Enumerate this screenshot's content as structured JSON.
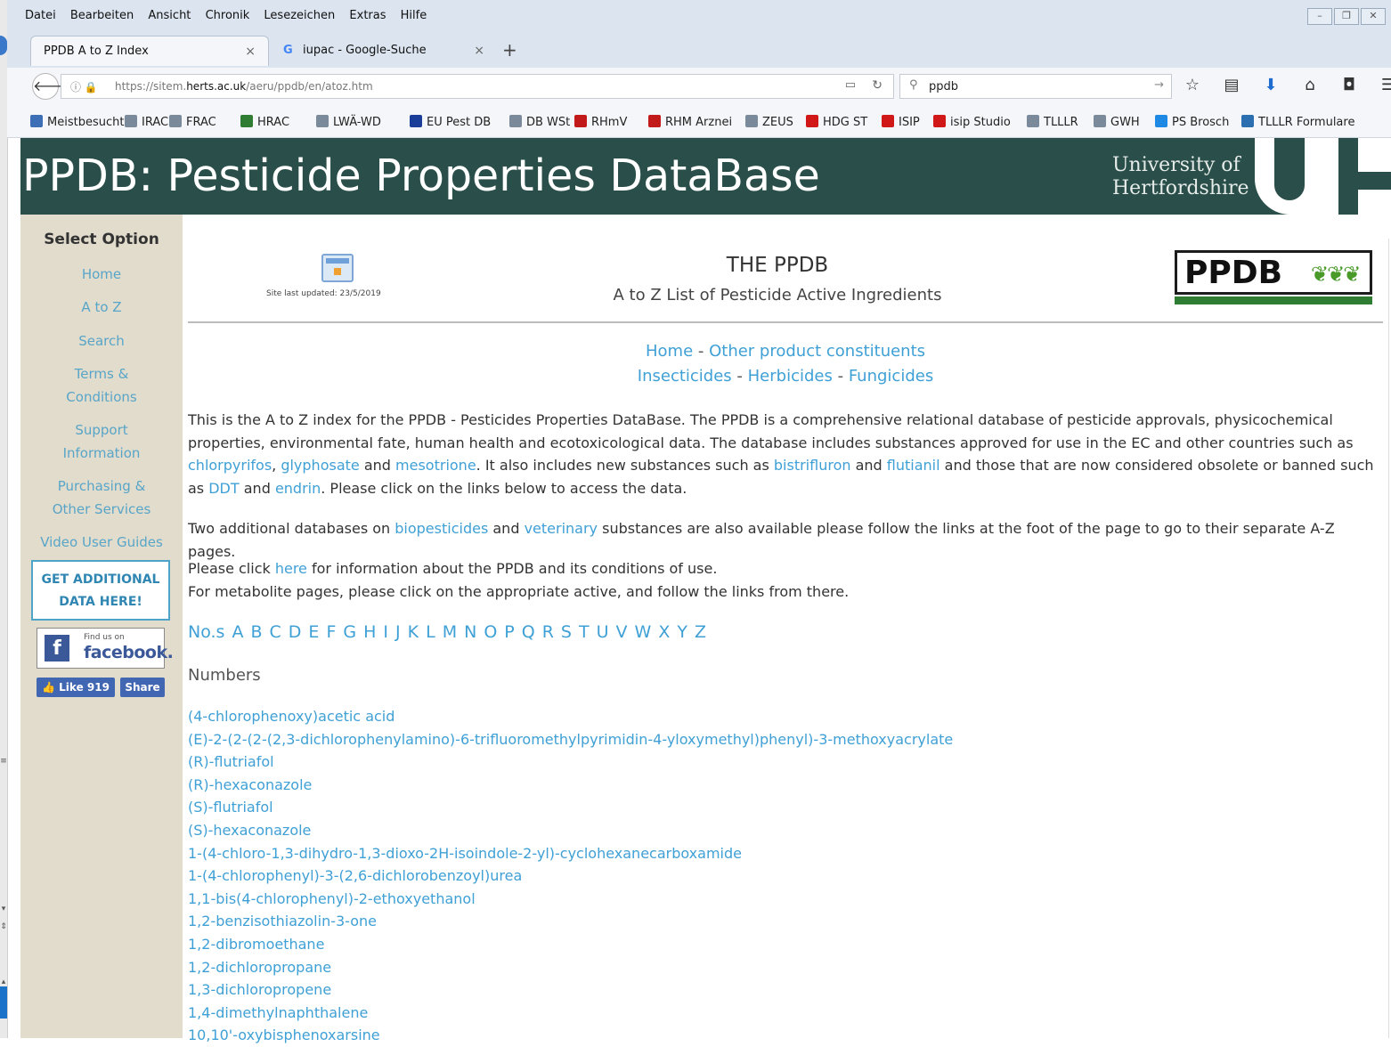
{
  "menu": [
    "Datei",
    "Bearbeiten",
    "Ansicht",
    "Chronik",
    "Lesezeichen",
    "Extras",
    "Hilfe"
  ],
  "tabs": [
    {
      "label": "PPDB A to Z Index",
      "close": "×"
    },
    {
      "label": "iupac - Google-Suche",
      "close": "×"
    }
  ],
  "nav": {
    "url_prefix": "https://sitem.",
    "url_domain": "herts.ac.uk",
    "url_suffix": "/aeru/ppdb/en/atoz.htm",
    "search_value": "ppdb"
  },
  "bookmarks": [
    {
      "label": "Meistbesucht",
      "color": "#3d6fb6"
    },
    {
      "label": "IRAC",
      "color": "#7a8a9a"
    },
    {
      "label": "FRAC",
      "color": "#7a8a9a"
    },
    {
      "label": "HRAC",
      "color": "#2f7d32"
    },
    {
      "label": "LWÄ-WD",
      "color": "#7a8a9a"
    },
    {
      "label": "EU Pest DB",
      "color": "#1a3d9a"
    },
    {
      "label": "DB WSt",
      "color": "#7a8a9a"
    },
    {
      "label": "RHmV",
      "color": "#c21a1a"
    },
    {
      "label": "RHM Arznei",
      "color": "#c21a1a"
    },
    {
      "label": "ZEUS",
      "color": "#7a8a9a"
    },
    {
      "label": "HDG ST",
      "color": "#d01818"
    },
    {
      "label": "ISIP",
      "color": "#d01818"
    },
    {
      "label": "isip Studio",
      "color": "#d01818"
    },
    {
      "label": "TLLLR",
      "color": "#7a8a9a"
    },
    {
      "label": "GWH",
      "color": "#7a8a9a"
    },
    {
      "label": "PS Brosch",
      "color": "#1e88e5"
    },
    {
      "label": "TLLLR Formulare",
      "color": "#2b6fb0"
    }
  ],
  "header": {
    "title": "PPDB: Pesticide Properties DataBase",
    "uni_line1": "University of",
    "uni_line2": "Hertfordshire"
  },
  "sidebar": {
    "heading": "Select Option",
    "items": [
      "Home",
      "A to Z",
      "Search",
      "Terms & Conditions",
      "Support Information",
      "Purchasing & Other Services",
      "Video User Guides"
    ],
    "get_data": "GET ADDITIONAL DATA HERE!",
    "fb_find": "Find us on",
    "fb_name": "facebook.",
    "like": "Like 919",
    "share": "Share"
  },
  "main": {
    "updated": "Site last updated: 23/5/2019",
    "title": "THE PPDB",
    "subtitle": "A to Z List of Pesticide Active Ingredients",
    "logo_text": "PPDB",
    "links": {
      "home": "Home",
      "other": "Other product constituents",
      "insecticides": "Insecticides",
      "herbicides": "Herbicides",
      "fungicides": "Fungicides",
      "sep": " - "
    },
    "p1": {
      "t1": "This is the A to Z index for the PPDB - Pesticides Properties DataBase. The PPDB is a comprehensive relational database of pesticide approvals, physicochemical properties, environmental fate, human health and ecotoxicological data. The database includes substances approved for use in the EC and other countries such as ",
      "l1": "chlorpyrifos",
      "t2": ", ",
      "l2": "glyphosate",
      "t3": " and ",
      "l3": "mesotrione",
      "t4": ". It also includes new substances such as ",
      "l4": "bistrifluron",
      "t5": " and ",
      "l5": "flutianil",
      "t6": " and those that are now considered obsolete or banned such as ",
      "l6": "DDT",
      "t7": " and ",
      "l7": "endrin",
      "t8": ". Please click on the links below to access the data."
    },
    "p2": {
      "t1": "Two additional databases on ",
      "l1": "biopesticides",
      "t2": " and ",
      "l2": "veterinary",
      "t3": " substances are also available please follow the links at the foot of the page to go to their separate A-Z pages."
    },
    "p3": {
      "t1": "Please click ",
      "l1": "here",
      "t2": " for information about the PPDB and its conditions of use.",
      "line2": "For metabolite pages, please click on the appropriate active, and follow the links from there."
    },
    "alphabet": [
      "No.s",
      "A",
      "B",
      "C",
      "D",
      "E",
      "F",
      "G",
      "H",
      "I",
      "J",
      "K",
      "L",
      "M",
      "N",
      "O",
      "P",
      "Q",
      "R",
      "S",
      "T",
      "U",
      "V",
      "W",
      "X",
      "Y",
      "Z"
    ],
    "numbers_heading": "Numbers",
    "substances": [
      "(4-chlorophenoxy)acetic acid",
      "(E)-2-(2-(2-(2,3-dichlorophenylamino)-6-trifluoromethylpyrimidin-4-yloxymethyl)phenyl)-3-methoxyacrylate",
      "(R)-flutriafol",
      "(R)-hexaconazole",
      "(S)-flutriafol",
      "(S)-hexaconazole",
      "1-(4-chloro-1,3-dihydro-1,3-dioxo-2H-isoindole-2-yl)-cyclohexanecarboxamide",
      "1-(4-chlorophenyl)-3-(2,6-dichlorobenzoyl)urea",
      "1,1-bis(4-chlorophenyl)-2-ethoxyethanol",
      "1,2-benzisothiazolin-3-one",
      "1,2-dibromoethane",
      "1,2-dichloropropane",
      "1,3-dichloropropene",
      "1,4-dimethylnaphthalene",
      "10,10'-oxybisphenoxarsine"
    ]
  }
}
